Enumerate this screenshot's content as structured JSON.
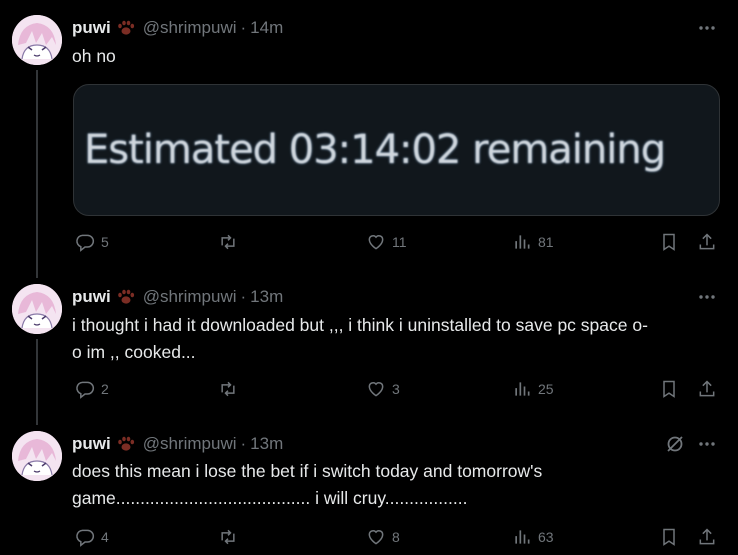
{
  "colors": {
    "background": "#000000",
    "text": "#e7e9ea",
    "muted": "#71767b",
    "line": "#333639",
    "card": "#11171c"
  },
  "tweets": [
    {
      "name": "puwi",
      "handle": "@shrimpuwi",
      "sep": "·",
      "time": "14m",
      "text": "oh no",
      "image_text": "Estimated 03:14:02 remaining",
      "replies": "5",
      "retweets": "",
      "likes": "11",
      "views": "81"
    },
    {
      "name": "puwi",
      "handle": "@shrimpuwi",
      "sep": "·",
      "time": "13m",
      "text_line1": "i thought i had it downloaded but ,,, i think i uninstalled to save pc space o-",
      "text_line2": "o im ,, cooked...",
      "replies": "2",
      "retweets": "",
      "likes": "3",
      "views": "25"
    },
    {
      "name": "puwi",
      "handle": "@shrimpuwi",
      "sep": "·",
      "time": "13m",
      "text_line1": "does this mean i lose the bet if i switch today and tomorrow's",
      "text_line2": "game........................................ i will cruy.................",
      "replies": "4",
      "retweets": "",
      "likes": "8",
      "views": "63"
    }
  ],
  "icons": [
    "paw-icon",
    "more-icon",
    "mute-icon",
    "reply-icon",
    "retweet-icon",
    "like-icon",
    "views-icon",
    "bookmark-icon",
    "share-icon"
  ]
}
